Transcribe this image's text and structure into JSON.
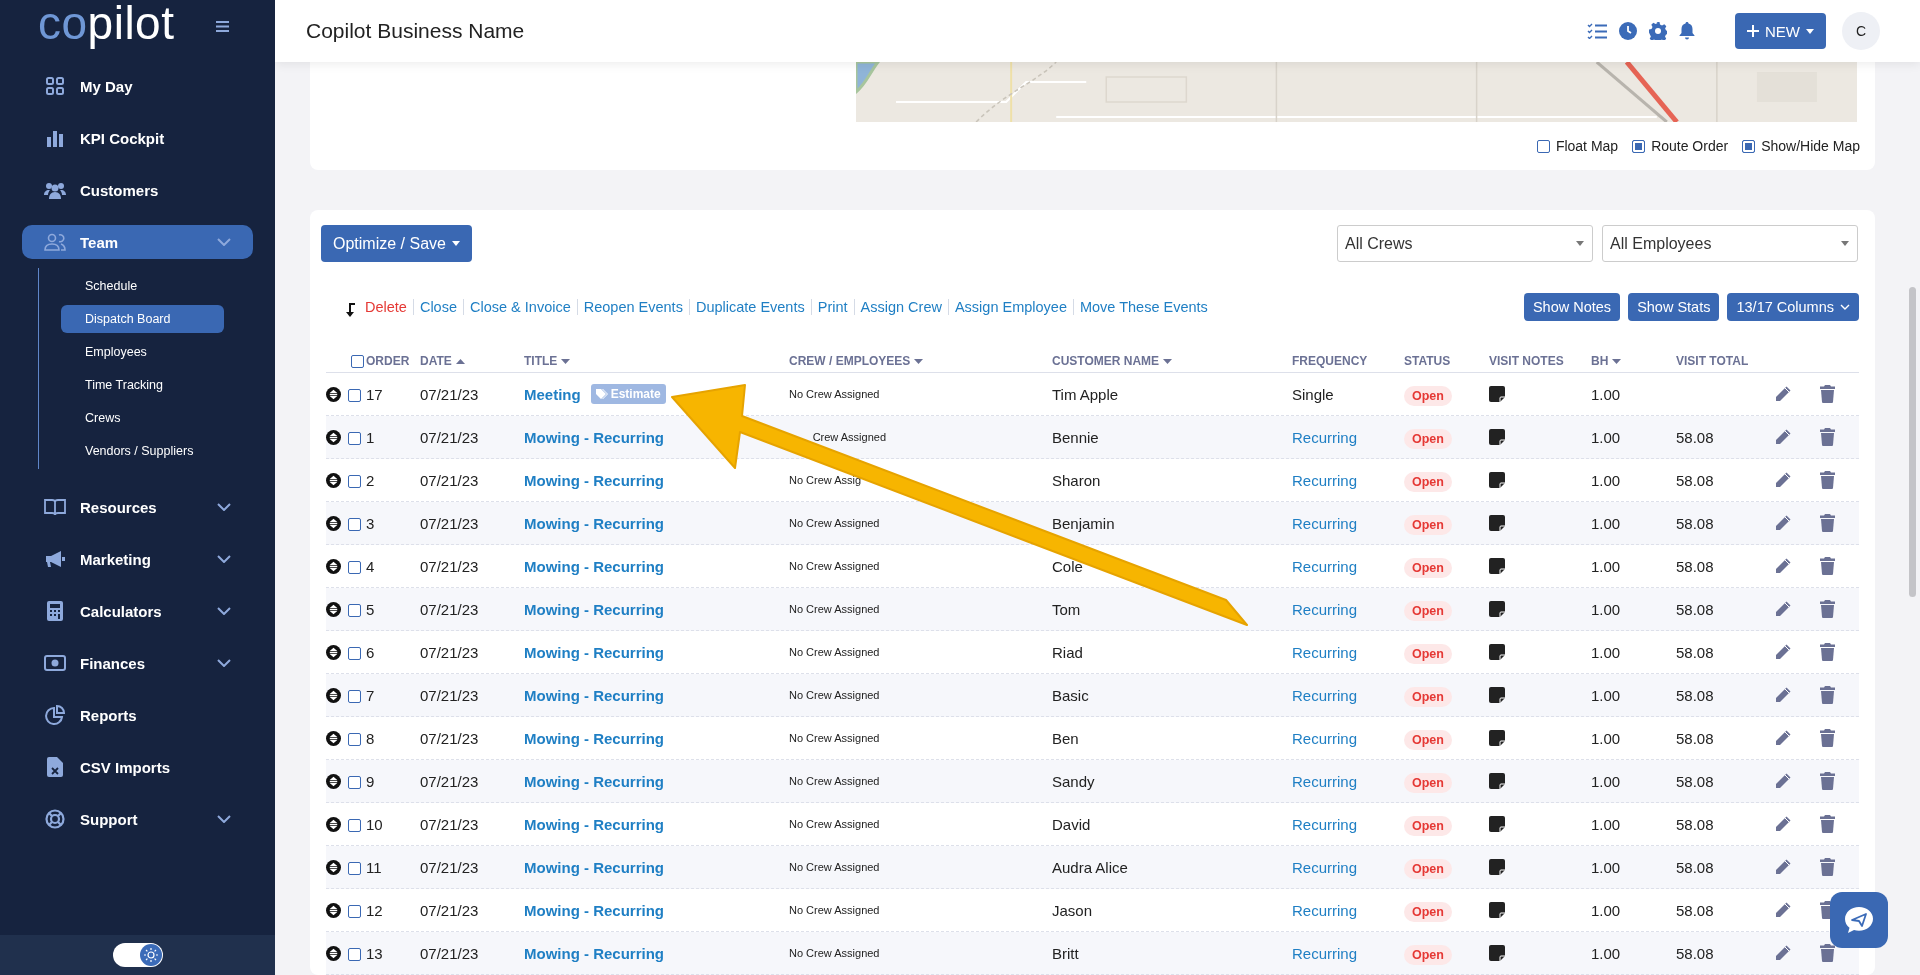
{
  "sidebar": {
    "logo": {
      "part_1": "co",
      "part_2": "pilot"
    },
    "items": [
      {
        "label": "My Day",
        "selected": false,
        "expandable": false
      },
      {
        "label": "KPI Cockpit",
        "selected": false,
        "expandable": false
      },
      {
        "label": "Customers",
        "selected": false,
        "expandable": false
      },
      {
        "label": "Team",
        "selected": true,
        "expandable": true,
        "children": [
          {
            "label": "Schedule",
            "selected": false
          },
          {
            "label": "Dispatch Board",
            "selected": true
          },
          {
            "label": "Employees",
            "selected": false
          },
          {
            "label": "Time Tracking",
            "selected": false
          },
          {
            "label": "Crews",
            "selected": false
          },
          {
            "label": "Vendors / Suppliers",
            "selected": false
          }
        ]
      },
      {
        "label": "Resources",
        "selected": false,
        "expandable": true
      },
      {
        "label": "Marketing",
        "selected": false,
        "expandable": true
      },
      {
        "label": "Calculators",
        "selected": false,
        "expandable": true
      },
      {
        "label": "Finances",
        "selected": false,
        "expandable": true
      },
      {
        "label": "Reports",
        "selected": false,
        "expandable": false
      },
      {
        "label": "CSV Imports",
        "selected": false,
        "expandable": false
      },
      {
        "label": "Support",
        "selected": false,
        "expandable": true
      }
    ],
    "theme_toggle": {
      "on": true
    }
  },
  "header": {
    "title": "Copilot Business Name",
    "new_button": "NEW",
    "avatar": "C"
  },
  "map": {
    "options": [
      {
        "label": "Float Map",
        "checked": false
      },
      {
        "label": "Route Order",
        "checked": true
      },
      {
        "label": "Show/Hide Map",
        "checked": true
      }
    ]
  },
  "toolbar": {
    "optimize_button": "Optimize / Save",
    "crew_select": "All Crews",
    "employee_select": "All Employees",
    "actions": [
      {
        "label": "Delete",
        "kind": "danger"
      },
      {
        "label": "Close",
        "kind": "link"
      },
      {
        "label": "Close & Invoice",
        "kind": "link"
      },
      {
        "label": "Reopen Events",
        "kind": "link"
      },
      {
        "label": "Duplicate Events",
        "kind": "link"
      },
      {
        "label": "Print",
        "kind": "link"
      },
      {
        "label": "Assign Crew",
        "kind": "link"
      },
      {
        "label": "Assign Employee",
        "kind": "link"
      },
      {
        "label": "Move These Events",
        "kind": "link"
      }
    ],
    "buttons": [
      {
        "label": "Show Notes",
        "kind": "plain"
      },
      {
        "label": "Show Stats",
        "kind": "plain"
      },
      {
        "label": "13/17 Columns",
        "kind": "dropdown"
      }
    ]
  },
  "table": {
    "select_all": {
      "checked": false
    },
    "columns": [
      {
        "label": "ORDER",
        "sorted": false
      },
      {
        "label": "DATE",
        "sorted": true,
        "ascending": true
      },
      {
        "label": "TITLE",
        "sorted": true,
        "ascending": false
      },
      {
        "label": "CREW / EMPLOYEES",
        "sorted": true,
        "ascending": false
      },
      {
        "label": "CUSTOMER NAME",
        "sorted": true,
        "ascending": false
      },
      {
        "label": "FREQUENCY",
        "sorted": false
      },
      {
        "label": "STATUS",
        "sorted": false
      },
      {
        "label": "VISIT NOTES",
        "sorted": false
      },
      {
        "label": "BH",
        "sorted": true,
        "ascending": false
      },
      {
        "label": "VISIT TOTAL",
        "sorted": false
      }
    ],
    "rows": [
      {
        "checked": false,
        "order": "17",
        "date": "07/21/23",
        "title": "Meeting",
        "tag": "Estimate",
        "crew": "No Crew Assigned",
        "customer": "Tim Apple",
        "frequency": "Single",
        "frequency_link": false,
        "status": "Open",
        "bh": "1.00"
      },
      {
        "checked": false,
        "order": "1",
        "date": "07/21/23",
        "title": "Mowing - Recurring",
        "crew": "Crew Assigned",
        "crew_cut_start": true,
        "customer": "Bennie",
        "frequency": "Recurring",
        "frequency_link": true,
        "status": "Open",
        "bh": "1.00",
        "total": "58.08"
      },
      {
        "checked": false,
        "order": "2",
        "date": "07/21/23",
        "title": "Mowing - Recurring",
        "crew": "No Crew Assig",
        "customer": "Sharon",
        "frequency": "Recurring",
        "frequency_link": true,
        "status": "Open",
        "bh": "1.00",
        "total": "58.08"
      },
      {
        "checked": false,
        "order": "3",
        "date": "07/21/23",
        "title": "Mowing - Recurring",
        "crew": "No Crew Assigned",
        "customer": "Benjamin",
        "frequency": "Recurring",
        "frequency_link": true,
        "status": "Open",
        "bh": "1.00",
        "total": "58.08"
      },
      {
        "checked": false,
        "order": "4",
        "date": "07/21/23",
        "title": "Mowing - Recurring",
        "crew": "No Crew Assigned",
        "customer": "Cole",
        "frequency": "Recurring",
        "frequency_link": true,
        "status": "Open",
        "bh": "1.00",
        "total": "58.08"
      },
      {
        "checked": false,
        "order": "5",
        "date": "07/21/23",
        "title": "Mowing - Recurring",
        "crew": "No Crew Assigned",
        "customer": "Tom",
        "frequency": "Recurring",
        "frequency_link": true,
        "status": "Open",
        "bh": "1.00",
        "total": "58.08"
      },
      {
        "checked": false,
        "order": "6",
        "date": "07/21/23",
        "title": "Mowing - Recurring",
        "crew": "No Crew Assigned",
        "customer": "Riad",
        "frequency": "Recurring",
        "frequency_link": true,
        "status": "Open",
        "bh": "1.00",
        "total": "58.08"
      },
      {
        "checked": false,
        "order": "7",
        "date": "07/21/23",
        "title": "Mowing - Recurring",
        "crew": "No Crew Assigned",
        "customer": "Basic",
        "frequency": "Recurring",
        "frequency_link": true,
        "status": "Open",
        "bh": "1.00",
        "total": "58.08"
      },
      {
        "checked": false,
        "order": "8",
        "date": "07/21/23",
        "title": "Mowing - Recurring",
        "crew": "No Crew Assigned",
        "customer": "Ben",
        "frequency": "Recurring",
        "frequency_link": true,
        "status": "Open",
        "bh": "1.00",
        "total": "58.08"
      },
      {
        "checked": false,
        "order": "9",
        "date": "07/21/23",
        "title": "Mowing - Recurring",
        "crew": "No Crew Assigned",
        "customer": "Sandy",
        "frequency": "Recurring",
        "frequency_link": true,
        "status": "Open",
        "bh": "1.00",
        "total": "58.08"
      },
      {
        "checked": false,
        "order": "10",
        "date": "07/21/23",
        "title": "Mowing - Recurring",
        "crew": "No Crew Assigned",
        "customer": "David",
        "frequency": "Recurring",
        "frequency_link": true,
        "status": "Open",
        "bh": "1.00",
        "total": "58.08"
      },
      {
        "checked": false,
        "order": "11",
        "date": "07/21/23",
        "title": "Mowing - Recurring",
        "crew": "No Crew Assigned",
        "customer": "Audra Alice",
        "frequency": "Recurring",
        "frequency_link": true,
        "status": "Open",
        "bh": "1.00",
        "total": "58.08"
      },
      {
        "checked": false,
        "order": "12",
        "date": "07/21/23",
        "title": "Mowing - Recurring",
        "crew": "No Crew Assigned",
        "customer": "Jason",
        "frequency": "Recurring",
        "frequency_link": true,
        "status": "Open",
        "bh": "1.00",
        "total": "58.08"
      },
      {
        "checked": false,
        "order": "13",
        "date": "07/21/23",
        "title": "Mowing - Recurring",
        "crew": "No Crew Assigned",
        "customer": "Britt",
        "frequency": "Recurring",
        "frequency_link": true,
        "status": "Open",
        "bh": "1.00",
        "total": "58.08"
      }
    ]
  }
}
